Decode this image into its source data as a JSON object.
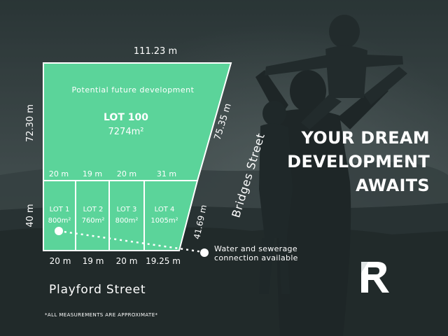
{
  "dimensions": {
    "top": "111.23 m",
    "left": "72.30 m",
    "right_upper": "75.35 m",
    "right_lower": "41.69 m",
    "lots_left": "40 m",
    "lot_widths_top": [
      "20 m",
      "19 m",
      "20 m",
      "31 m"
    ],
    "lot_widths_bottom": [
      "20 m",
      "19 m",
      "20 m",
      "19.25 m"
    ]
  },
  "lot100": {
    "subtitle": "Potential future development",
    "name": "LOT 100",
    "area": "7274m²"
  },
  "lots": [
    {
      "name": "LOT 1",
      "area": "800m²"
    },
    {
      "name": "LOT 2",
      "area": "760m²"
    },
    {
      "name": "LOT 3",
      "area": "800m²"
    },
    {
      "name": "LOT 4",
      "area": "1005m²"
    }
  ],
  "streets": {
    "bottom": "Playford Street",
    "right": "Bridges Street"
  },
  "services": {
    "line1": "Water and sewerage",
    "line2": "connection available"
  },
  "disclaimer": "*ALL MEASUREMENTS ARE APPROXIMATE*",
  "tagline": [
    "YOUR DREAM",
    "DEVELOPMENT",
    "AWAITS"
  ],
  "logo_icon": "r-monogram-icon",
  "colors": {
    "lot_green": "#5bd49a",
    "background": "#2f3a3b",
    "text": "#ffffff"
  }
}
